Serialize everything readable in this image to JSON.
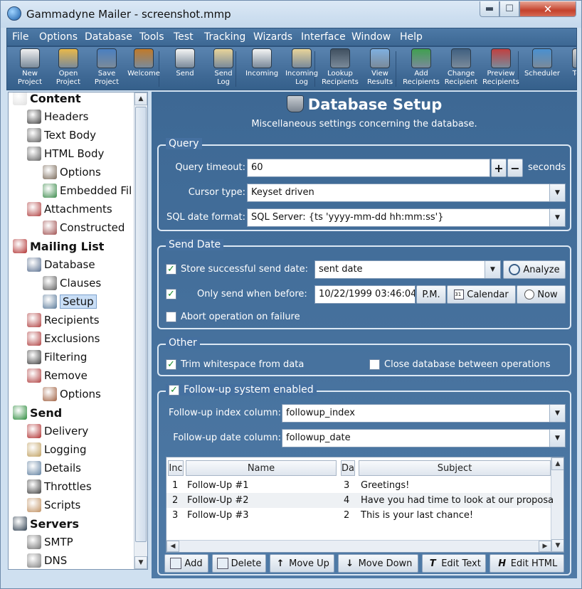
{
  "window": {
    "title": "Gammadyne Mailer - screenshot.mmp"
  },
  "menu": [
    "File",
    "Options",
    "Database",
    "Tools",
    "Test",
    "Tracking",
    "Wizards",
    "Interface",
    "Window",
    "Help"
  ],
  "menu_underline": [
    "F",
    "O",
    "D",
    "T",
    "e",
    "T",
    "z",
    "I",
    "W",
    "H"
  ],
  "toolbar": [
    {
      "label1": "New",
      "label2": "Project",
      "icon": "new-project-icon"
    },
    {
      "label1": "Open",
      "label2": "Project",
      "icon": "open-project-icon"
    },
    {
      "label1": "Save",
      "label2": "Project",
      "icon": "save-project-icon"
    },
    {
      "label1": "Welcome",
      "label2": "",
      "icon": "welcome-door-icon"
    },
    {
      "label1": "Send",
      "label2": "",
      "icon": "send-icon"
    },
    {
      "label1": "Send",
      "label2": "Log",
      "icon": "send-log-icon"
    },
    {
      "label1": "Incoming",
      "label2": "",
      "icon": "incoming-icon"
    },
    {
      "label1": "Incoming",
      "label2": "Log",
      "icon": "incoming-log-icon"
    },
    {
      "label1": "Lookup",
      "label2": "Recipients",
      "icon": "lookup-recipients-icon"
    },
    {
      "label1": "View",
      "label2": "Results",
      "icon": "view-results-icon"
    },
    {
      "label1": "Add",
      "label2": "Recipients",
      "icon": "add-recipients-icon"
    },
    {
      "label1": "Change",
      "label2": "Recipient",
      "icon": "change-recipient-icon"
    },
    {
      "label1": "Preview",
      "label2": "Recipients",
      "icon": "preview-recipients-icon"
    },
    {
      "label1": "Scheduler",
      "label2": "",
      "icon": "scheduler-clock-icon"
    },
    {
      "label1": "Temp",
      "label2": "",
      "icon": "templates-icon"
    }
  ],
  "tree": [
    {
      "label": "Content",
      "bold": true
    },
    {
      "label": "Headers"
    },
    {
      "label": "Text Body"
    },
    {
      "label": "HTML Body"
    },
    {
      "label": "Options"
    },
    {
      "label": "Embedded Fil"
    },
    {
      "label": "Attachments"
    },
    {
      "label": "Constructed"
    },
    {
      "label": "Mailing List",
      "bold": true
    },
    {
      "label": "Database"
    },
    {
      "label": "Clauses"
    },
    {
      "label": "Setup",
      "selected": true
    },
    {
      "label": "Recipients"
    },
    {
      "label": "Exclusions"
    },
    {
      "label": "Filtering"
    },
    {
      "label": "Remove"
    },
    {
      "label": "Options"
    },
    {
      "label": "Send",
      "bold": true
    },
    {
      "label": "Delivery"
    },
    {
      "label": "Logging"
    },
    {
      "label": "Details"
    },
    {
      "label": "Throttles"
    },
    {
      "label": "Scripts"
    },
    {
      "label": "Servers",
      "bold": true
    },
    {
      "label": "SMTP"
    },
    {
      "label": "DNS"
    }
  ],
  "page": {
    "title": "Database Setup",
    "subtitle": "Miscellaneous settings concerning the database."
  },
  "query": {
    "title": "Query",
    "timeout_label": "Query timeout:",
    "timeout_value": "60",
    "timeout_unit": "seconds",
    "cursor_label": "Cursor type:",
    "cursor_value": "Keyset driven",
    "date_format_label": "SQL date format:",
    "date_format_value": "SQL Server:  {ts 'yyyy-mm-dd hh:mm:ss'}"
  },
  "send_date": {
    "title": "Send Date",
    "store_label": "Store successful send date:",
    "store_checked": true,
    "store_value": "sent date",
    "analyze_label": "Analyze",
    "only_send_label": "Only send when before:",
    "only_send_checked": true,
    "only_send_value": "10/22/1999 03:46:04",
    "pm_label": "P.M.",
    "calendar_label": "Calendar",
    "now_label": "Now",
    "abort_label": "Abort operation on failure",
    "abort_checked": false
  },
  "other": {
    "title": "Other",
    "trim_label": "Trim whitespace from data",
    "trim_checked": true,
    "close_label": "Close database between operations",
    "close_checked": false
  },
  "followup": {
    "title": "Follow-up system enabled",
    "enabled": true,
    "index_label": "Follow-up index column:",
    "index_value": "followup_index",
    "date_label": "Follow-up date column:",
    "date_value": "followup_date",
    "columns": [
      "Inc",
      "Name",
      "Da",
      "Subject"
    ],
    "rows": [
      {
        "index": "1",
        "name": "Follow-Up #1",
        "days": "3",
        "subject": "Greetings!"
      },
      {
        "index": "2",
        "name": "Follow-Up #2",
        "days": "4",
        "subject": "Have you had time to look at our proposa"
      },
      {
        "index": "3",
        "name": "Follow-Up #3",
        "days": "2",
        "subject": "This is your last chance!"
      }
    ],
    "buttons": [
      "Add",
      "Delete",
      "Move Up",
      "Move Down",
      "Edit Text",
      "Edit HTML"
    ]
  }
}
